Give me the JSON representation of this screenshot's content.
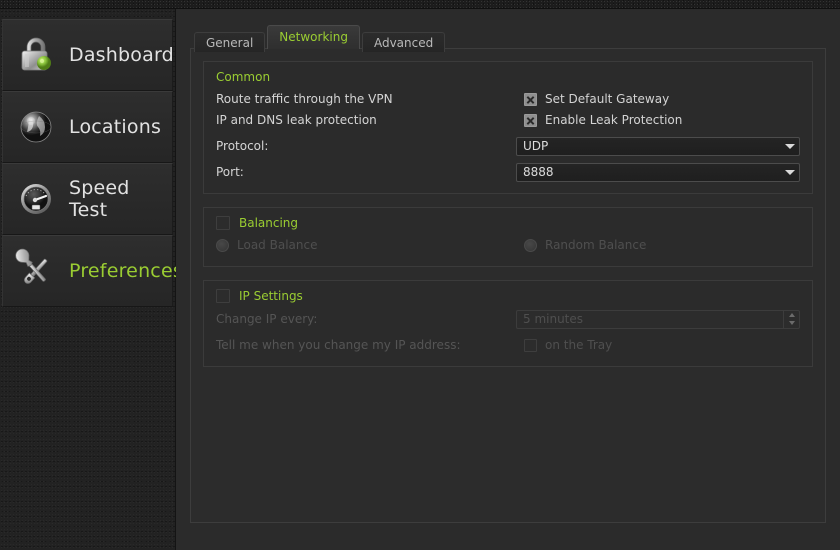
{
  "app": {
    "accent_color": "#9acd32",
    "bg_color": "#2b2b2b",
    "text_color": "#d4d4d4",
    "disabled_color": "#4f4f4f"
  },
  "sidebar": {
    "items": [
      {
        "label": "Dashboard",
        "icon": "padlock-icon",
        "active": false
      },
      {
        "label": "Locations",
        "icon": "globe-icon",
        "active": false
      },
      {
        "label": "Speed Test",
        "icon": "speedometer-icon",
        "active": false
      },
      {
        "label": "Preferences",
        "icon": "tools-icon",
        "active": true
      }
    ]
  },
  "tabs": [
    {
      "label": "General",
      "selected": false
    },
    {
      "label": "Networking",
      "selected": true
    },
    {
      "label": "Advanced",
      "selected": false
    }
  ],
  "common": {
    "title": "Common",
    "route_label": "Route traffic through the VPN",
    "gateway_checkbox_label": "Set Default Gateway",
    "gateway_checked": true,
    "leak_label": "IP and DNS leak protection",
    "leak_checkbox_label": "Enable Leak Protection",
    "leak_checked": true,
    "protocol_label": "Protocol:",
    "protocol_value": "UDP",
    "port_label": "Port:",
    "port_value": "8888"
  },
  "balancing": {
    "title": "Balancing",
    "enabled": false,
    "load_balance_label": "Load Balance",
    "random_balance_label": "Random Balance"
  },
  "ip_settings": {
    "title": "IP Settings",
    "enabled": false,
    "change_ip_label": "Change IP every:",
    "change_ip_value": "5 minutes",
    "notify_label": "Tell me when you change my IP address:",
    "tray_label": "on the Tray",
    "tray_checked": false
  }
}
